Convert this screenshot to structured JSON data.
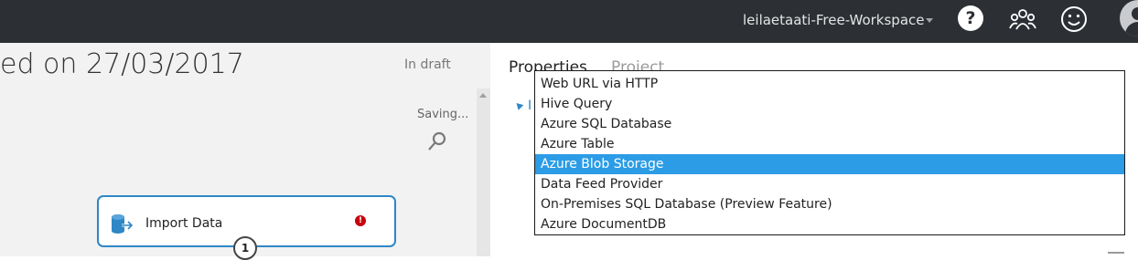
{
  "header": {
    "workspace": "leilaetaati-Free-Workspace",
    "icons": [
      "help-icon",
      "community-icon",
      "smiley-icon",
      "avatar"
    ]
  },
  "canvas": {
    "title": "ed on 27/03/2017",
    "status": "In draft",
    "saving": "Saving...",
    "module": {
      "label": "Import Data",
      "error_glyph": "!",
      "port_number": "1"
    }
  },
  "properties": {
    "tabs": [
      "Properties",
      "Project"
    ],
    "tree_label": "I",
    "dropdown": {
      "options": [
        "Web URL via HTTP",
        "Hive Query",
        "Azure SQL Database",
        "Azure Table",
        "Azure Blob Storage",
        "Data Feed Provider",
        "On-Premises SQL Database (Preview Feature)",
        "Azure DocumentDB"
      ],
      "selected": "Azure Blob Storage"
    }
  },
  "colors": {
    "topbar": "#2c3035",
    "accent": "#2e87c6",
    "selection": "#2c9ce6",
    "error": "#c8000e"
  }
}
